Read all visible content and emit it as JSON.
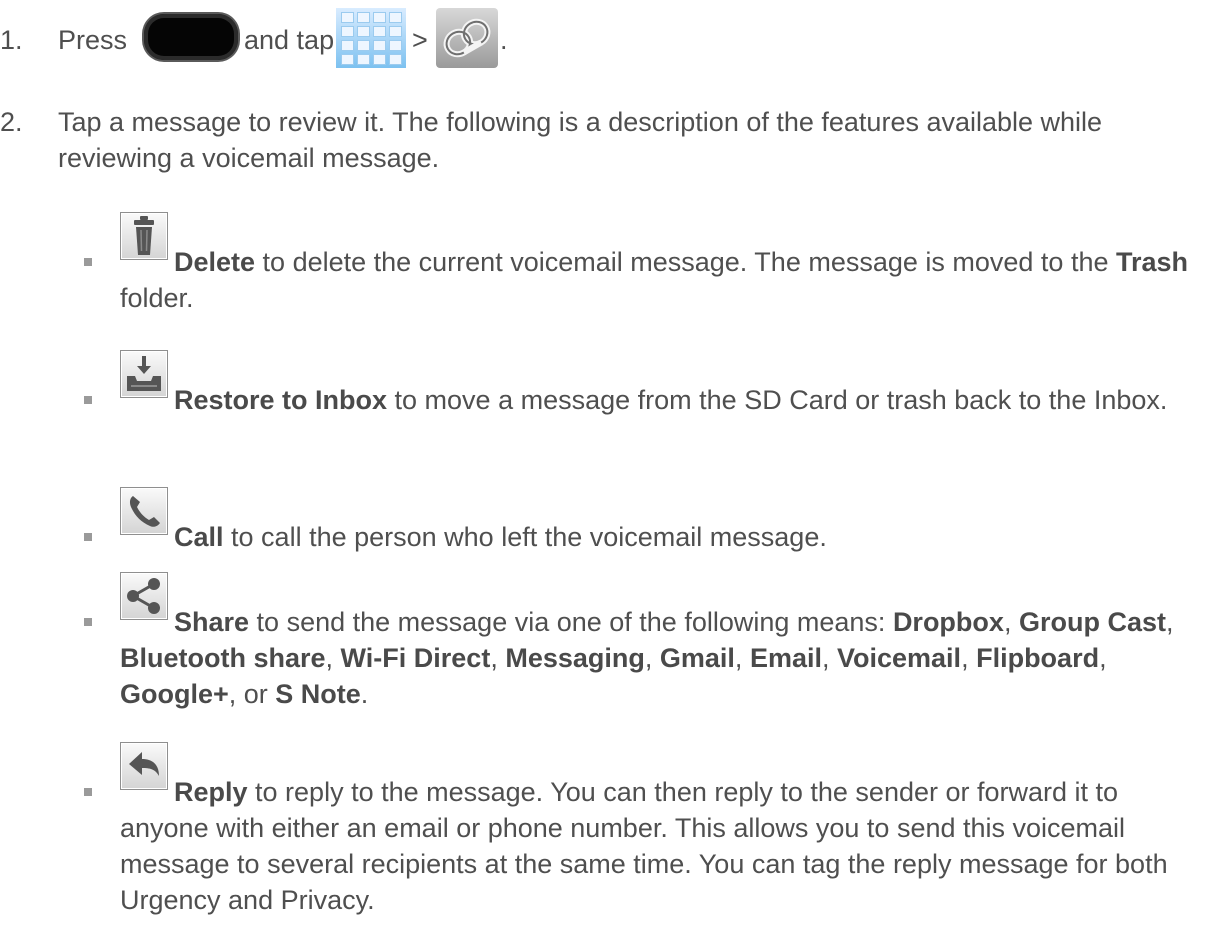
{
  "steps": [
    {
      "number": "1.",
      "word_press": "Press",
      "word_and_tap": "and tap",
      "separator": ">",
      "period": ".",
      "icons": [
        "home-key-icon",
        "apps-grid-icon",
        "voicemail-icon"
      ]
    },
    {
      "number": "2.",
      "text": "Tap a message to review it. The following is a description of the features available while reviewing a voicemail message."
    }
  ],
  "options": [
    {
      "icon": "trash-icon",
      "label": "Delete",
      "text_1": " to delete the current voicemail message. The message is moved to the ",
      "bold_2": "Trash",
      "text_2": " folder."
    },
    {
      "icon": "restore-inbox-icon",
      "label": "Restore to Inbox",
      "text_1": " to move a message from the SD Card or trash back to the Inbox."
    },
    {
      "icon": "phone-icon",
      "label": "Call",
      "text_1": " to call the person who left the voicemail message."
    },
    {
      "icon": "share-icon",
      "label": "Share",
      "text_1": " to send the message via one of the following means: ",
      "means": [
        "Dropbox",
        "Group Cast",
        "Bluetooth share",
        "Wi-Fi Direct",
        "Messaging",
        "Gmail",
        "Email",
        "Voicemail",
        "Flipboard",
        "Google+",
        "S Note"
      ],
      "sep": ", ",
      "last_sep": ", or ",
      "end": "."
    },
    {
      "icon": "reply-icon",
      "label": "Reply",
      "text_1": " to reply to the message. You can then reply to the sender or forward it to anyone with either an email or phone number. This allows you to send this voicemail message to several recipients at the same time. You can tag the reply message for both Urgency and Privacy."
    }
  ]
}
